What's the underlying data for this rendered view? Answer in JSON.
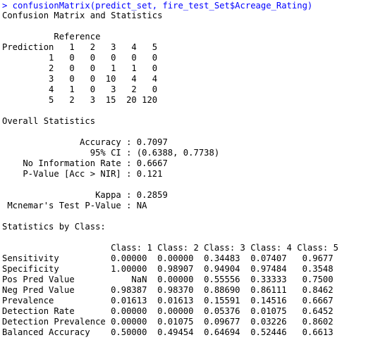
{
  "console": {
    "command": "> confusionMatrix(predict_set, fire_test_Set$Acreage_Rating)",
    "output": [
      "Confusion Matrix and Statistics",
      "",
      "          Reference",
      "Prediction   1   2   3   4   5",
      "         1   0   0   0   0   0",
      "         2   0   0   1   1   0",
      "         3   0   0  10   4   4",
      "         4   1   0   3   2   0",
      "         5   2   3  15  20 120",
      "",
      "Overall Statistics",
      "",
      "               Accuracy : 0.7097",
      "                 95% CI : (0.6388, 0.7738)",
      "    No Information Rate : 0.6667",
      "    P-Value [Acc > NIR] : 0.121",
      "",
      "                  Kappa : 0.2859",
      " Mcnemar's Test P-Value : NA",
      "",
      "Statistics by Class:",
      "",
      "                     Class: 1 Class: 2 Class: 3 Class: 4 Class: 5",
      "Sensitivity          0.00000  0.00000  0.34483  0.07407   0.9677",
      "Specificity          1.00000  0.98907  0.94904  0.97484   0.3548",
      "Pos Pred Value           NaN  0.00000  0.55556  0.33333   0.7500",
      "Neg Pred Value       0.98387  0.98370  0.88690  0.86111   0.8462",
      "Prevalence           0.01613  0.01613  0.15591  0.14516   0.6667",
      "Detection Rate       0.00000  0.00000  0.05376  0.01075   0.6452",
      "Detection Prevalence 0.00000  0.01075  0.09677  0.03226   0.8602",
      "Balanced Accuracy    0.50000  0.49454  0.64694  0.52446   0.6613"
    ]
  },
  "colors": {
    "command": "#0000ff",
    "output": "#000000",
    "background": "#ffffff"
  }
}
